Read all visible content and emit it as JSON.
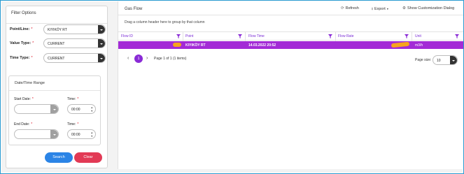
{
  "filter": {
    "title": "Filter Options",
    "point_label": "Point/Line:",
    "point_value": "KIYIKÖY RT",
    "value_type_label": "Value Type:",
    "value_type_value": "CURRENT",
    "time_type_label": "Time Type:",
    "time_type_value": "CURRENT",
    "required_mark": "*"
  },
  "date_range": {
    "title": "Date/Time Range",
    "start_date_label": "Start Date:",
    "start_time_label": "Time:",
    "start_time_value": "00:00",
    "end_date_label": "End Date:",
    "end_time_label": "Time:",
    "end_time_value": "00:00"
  },
  "actions": {
    "search": "Search",
    "clear": "Clear"
  },
  "grid": {
    "title": "Gas Flow",
    "refresh": "Refresh",
    "export": "Export",
    "customize": "Show Customization Dialog",
    "group_hint": "Drag a column header here to group by that column",
    "columns": [
      "Flow ID",
      "Point",
      "Flow Time",
      "Flow Rate",
      "Unit"
    ],
    "row": {
      "flow_id": "",
      "point": "KIYIKÖY RT",
      "flow_time": "14.03.2022 20:52",
      "flow_rate": "",
      "unit": "m3/h"
    },
    "page_current": "1",
    "page_info": "Page 1 of 1 (1 items)",
    "page_size_label": "Page size:",
    "page_size_value": "10"
  },
  "colors": {
    "accent": "#a32bd6",
    "search": "#2b84e6",
    "clear": "#e23a55",
    "highlight": "#f7a41c"
  },
  "icons": [
    "chevron-down-icon",
    "filter-icon",
    "refresh-icon",
    "export-icon",
    "gear-icon",
    "chevron-left-icon",
    "chevron-right-icon"
  ]
}
